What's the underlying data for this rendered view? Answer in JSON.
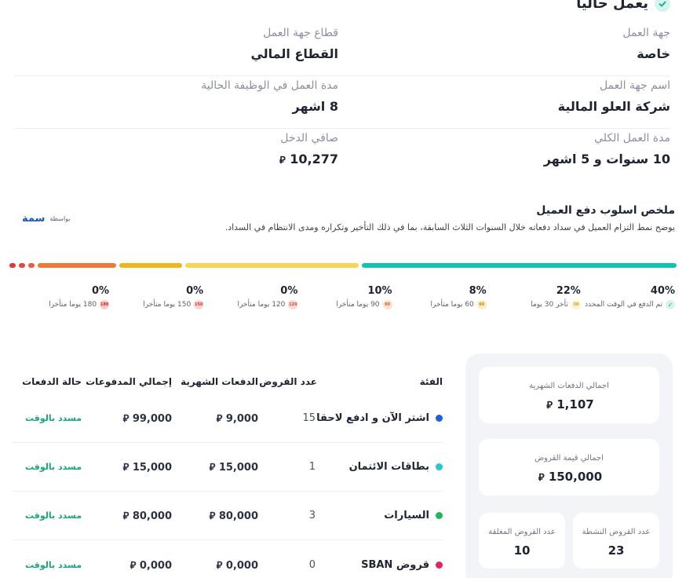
{
  "employment": {
    "status": "يعمل حاليا",
    "rows": [
      {
        "right": {
          "label": "جهة العمل",
          "value": "خاصة"
        },
        "left": {
          "label": "قطاع جهة العمل",
          "value": "القطاع المالي"
        }
      },
      {
        "right": {
          "label": "اسم جهة العمل",
          "value": "شركة العلو المالية"
        },
        "left": {
          "label": "مدة العمل في الوظيفة الحالية",
          "value": "8 اشهر"
        }
      },
      {
        "right": {
          "label": "مدة العمل الكلي",
          "value": "10 سنوات و 5 اشهر"
        },
        "left": {
          "label": "صافي الدخل",
          "value": "10,277"
        }
      }
    ]
  },
  "currency_symbol": "⃁",
  "summary": {
    "title": "ملخص اسلوب دفع العميل",
    "description": "يوضح نمط التزام العميل في سداد دفعاته خلال السنوات الثلاث السابقة، بما في ذلك التأخير وتكراره ومدى الانتظام في السداد.",
    "powered_by": "بواسطة",
    "logo": "سمة"
  },
  "payment_behavior": [
    {
      "pct": "40%",
      "value": 40,
      "label": "تم الدفع في الوقت المحدد",
      "badge": "✓",
      "color": "#10c4b1",
      "badge_bg": "#d5f5ec",
      "badge_fg": "#10a990"
    },
    {
      "pct": "22%",
      "value": 22,
      "label": "تأخر 30 يوما",
      "badge": "30",
      "color": "#f7d55a",
      "badge_bg": "#fdf3c9",
      "badge_fg": "#c9a11a"
    },
    {
      "pct": "8%",
      "value": 8,
      "label": "60 يوما متأخرا",
      "badge": "60",
      "color": "#f1b51c",
      "badge_bg": "#fdecc0",
      "badge_fg": "#c48d05"
    },
    {
      "pct": "10%",
      "value": 10,
      "label": "90 يوما متأخرا",
      "badge": "90",
      "color": "#ee7a3a",
      "badge_bg": "#fde0cf",
      "badge_fg": "#d0642a"
    },
    {
      "pct": "0%",
      "value": 0,
      "label": "120 يوما متأخرا",
      "badge": "120",
      "color": "#e85a4c",
      "badge_bg": "#fbd7d3",
      "badge_fg": "#d44a3c"
    },
    {
      "pct": "0%",
      "value": 0,
      "label": "150 يوما متأخرا",
      "badge": "150",
      "color": "#e04848",
      "badge_bg": "#fbd3d3",
      "badge_fg": "#cf3a3a"
    },
    {
      "pct": "0%",
      "value": 0,
      "label": "180 يوما متأخرا",
      "badge": "180",
      "color": "#d83a3a",
      "badge_bg": "#f9cccc",
      "badge_fg": "#c42a2a"
    }
  ],
  "loans": {
    "headers": [
      "الفئة",
      "عدد القروض",
      "الدفعات الشهرية",
      "إجمالي المدفوعات",
      "حالة الدفعات"
    ],
    "rows": [
      {
        "category": "اشتر الآن و ادفع لاحقا",
        "color": "#1f5fe0",
        "count": "15",
        "monthly": "9,000",
        "total": "99,000",
        "status": "مسدد بالوقت"
      },
      {
        "category": "بطاقات الائتمان",
        "color": "#22c7d6",
        "count": "1",
        "monthly": "15,000",
        "total": "15,000",
        "status": "مسدد بالوقت"
      },
      {
        "category": "السيارات",
        "color": "#21b55a",
        "count": "3",
        "monthly": "80,000",
        "total": "80,000",
        "status": "مسدد بالوقت"
      },
      {
        "category": "قروض SBAN",
        "color": "#e0245e",
        "count": "0",
        "monthly": "0,000",
        "total": "0,000",
        "status": "مسدد بالوقت"
      }
    ]
  },
  "totals": {
    "monthly_label": "اجمالي الدفعات الشهرية",
    "monthly_value": "1,107",
    "loans_value_label": "اجمالي قيمة القروض",
    "loans_value": "150,000",
    "active_label": "عدد القروض النشطة",
    "active_value": "23",
    "closed_label": "عدد القروض المغلقة",
    "closed_value": "10"
  }
}
